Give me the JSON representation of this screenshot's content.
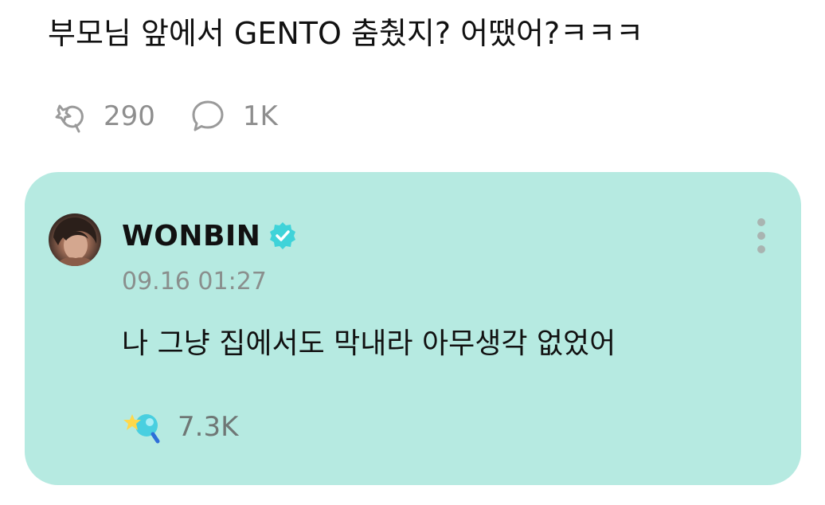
{
  "post": {
    "text": "부모님 앞에서 GENTO 춤췄지? 어땠어?ㅋㅋㅋ",
    "stats": {
      "likes": "290",
      "comments": "1K"
    }
  },
  "reply": {
    "author": "WONBIN",
    "timestamp": "09.16 01:27",
    "text": "나 그냥 집에서도 막내라 아무생각 없었어",
    "likes": "7.3K"
  },
  "colors": {
    "card_background": "#b6eae1",
    "verified_badge": "#3fd3d9",
    "muted_text": "#8e8e8e"
  },
  "icons": {
    "like": "comet-like-icon",
    "comment": "speech-bubble-icon",
    "verified": "verified-badge-icon",
    "more": "vertical-ellipsis-icon",
    "reply_like": "colored-comet-like-icon"
  }
}
